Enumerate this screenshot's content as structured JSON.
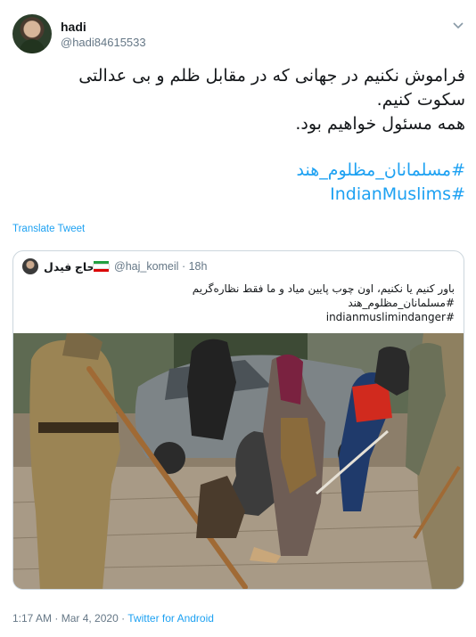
{
  "author": {
    "name": "hadi",
    "handle": "@hadi84615533"
  },
  "menu_icon": "chevron-down-icon",
  "tweet": {
    "lines": [
      "فراموش نکنیم در جهانی که در مقابل ظلم و بی عدالتی",
      "سکوت کنیم.",
      "همه مسئول خواهیم بود."
    ],
    "hashtags": [
      "#مسلمانان_مظلوم_هند",
      "#IndianMuslims"
    ],
    "hashtag_color": "#1da1f2"
  },
  "translate_label": "Translate Tweet",
  "quoted": {
    "name": "حاج فیدل",
    "handle": "@haj_komeil",
    "separator": "·",
    "time": "18h",
    "lines": [
      "باور کنیم یا نکنیم، اون چوب پایین میاد و ما فقط نظاره‌گریم",
      "#مسلمانان_مظلوم_هند",
      "#indianmuslimindanger"
    ],
    "flag_colors": [
      "#239f40",
      "#ffffff",
      "#da0000"
    ]
  },
  "footer": {
    "time": "1:17 AM",
    "separator1": "·",
    "date": "Mar 4, 2020",
    "separator2": "·",
    "source": "Twitter for Android"
  }
}
